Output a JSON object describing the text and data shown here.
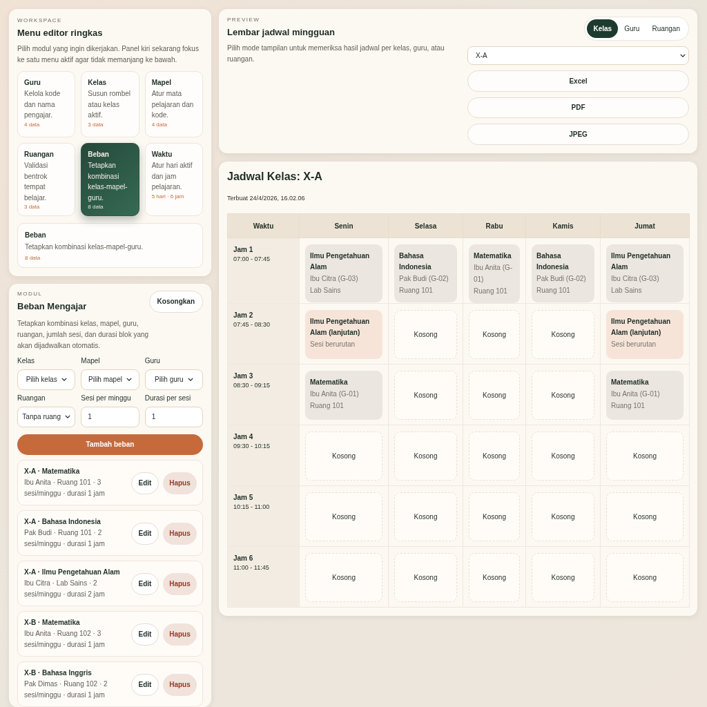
{
  "workspace": {
    "eyebrow": "WORKSPACE",
    "title": "Menu editor ringkas",
    "description": "Pilih modul yang ingin dikerjakan. Panel kiri sekarang fokus ke satu menu aktif agar tidak memanjang ke bawah.",
    "modules": [
      {
        "title": "Guru",
        "description": "Kelola kode dan nama pengajar.",
        "count": "4 data",
        "selected": false
      },
      {
        "title": "Kelas",
        "description": "Susun rombel atau kelas aktif.",
        "count": "3 data",
        "selected": false
      },
      {
        "title": "Mapel",
        "description": "Atur mata pelajaran dan kode.",
        "count": "4 data",
        "selected": false
      },
      {
        "title": "Ruangan",
        "description": "Validasi bentrok tempat belajar.",
        "count": "3 data",
        "selected": false
      },
      {
        "title": "Beban",
        "description": "Tetapkan kombinasi kelas-mapel-guru.",
        "count": "8 data",
        "selected": true
      },
      {
        "title": "Waktu",
        "description": "Atur hari aktif dan jam pelajaran.",
        "count": "5 hari · 6 jam",
        "selected": false
      }
    ],
    "active": {
      "title": "Beban",
      "description": "Tetapkan kombinasi kelas-mapel-guru.",
      "count": "8 data"
    }
  },
  "module": {
    "eyebrow": "MODUL",
    "title": "Beban Mengajar",
    "clear_button": "Kosongkan",
    "description": "Tetapkan kombinasi kelas, mapel, guru, ruangan, jumlah sesi, dan durasi blok yang akan dijadwalkan otomatis.",
    "fields": [
      {
        "label": "Kelas",
        "kind": "select",
        "value": "Pilih kelas"
      },
      {
        "label": "Mapel",
        "kind": "select",
        "value": "Pilih mapel"
      },
      {
        "label": "Guru",
        "kind": "select",
        "value": "Pilih guru"
      },
      {
        "label": "Ruangan",
        "kind": "select",
        "value": "Tanpa ruang"
      },
      {
        "label": "Sesi per minggu",
        "kind": "number",
        "value": "1"
      },
      {
        "label": "Durasi per sesi",
        "kind": "number",
        "value": "1"
      }
    ],
    "submit_button": "Tambah beban",
    "loads": [
      {
        "title": "X-A · Matematika",
        "detail": "Ibu Anita · Ruang 101 · 3 sesi/minggu · durasi 1 jam",
        "edit": "Edit",
        "delete": "Hapus"
      },
      {
        "title": "X-A · Bahasa Indonesia",
        "detail": "Pak Budi · Ruang 101 · 2 sesi/minggu · durasi 1 jam",
        "edit": "Edit",
        "delete": "Hapus"
      },
      {
        "title": "X-A · Ilmu Pengetahuan Alam",
        "detail": "Ibu Citra · Lab Sains · 2 sesi/minggu · durasi 2 jam",
        "edit": "Edit",
        "delete": "Hapus"
      },
      {
        "title": "X-B · Matematika",
        "detail": "Ibu Anita · Ruang 102 · 3 sesi/minggu · durasi 1 jam",
        "edit": "Edit",
        "delete": "Hapus"
      },
      {
        "title": "X-B · Bahasa Inggris",
        "detail": "Pak Dimas · Ruang 102 · 2 sesi/minggu · durasi 1 jam",
        "edit": "Edit",
        "delete": "Hapus"
      }
    ]
  },
  "preview": {
    "eyebrow": "PREVIEW",
    "title": "Lembar jadwal mingguan",
    "description": "Pilih mode tampilan untuk memeriksa hasil jadwal per kelas, guru, atau ruangan.",
    "modes": [
      {
        "label": "Kelas",
        "selected": true
      },
      {
        "label": "Guru",
        "selected": false
      },
      {
        "label": "Ruangan",
        "selected": false
      }
    ],
    "target": "X-A",
    "exports": [
      "Excel",
      "PDF",
      "JPEG"
    ]
  },
  "schedule": {
    "title": "Jadwal Kelas: X-A",
    "generated": "Terbuat 24/4/2026, 16.02.06",
    "columns": [
      "Waktu",
      "Senin",
      "Selasa",
      "Rabu",
      "Kamis",
      "Jumat"
    ],
    "rows": [
      {
        "cells": [
          {
            "kind": "time",
            "title": "Jam 1",
            "lines": [
              "07:00 - 07:45"
            ]
          },
          {
            "kind": "lesson",
            "title": "Ilmu Pengetahuan Alam",
            "lines": [
              "Ibu Citra (G-03)",
              "Lab Sains"
            ]
          },
          {
            "kind": "lesson",
            "title": "Bahasa Indonesia",
            "lines": [
              "Pak Budi (G-02)",
              "Ruang 101"
            ]
          },
          {
            "kind": "lesson",
            "title": "Matematika",
            "lines": [
              "Ibu Anita (G-01)",
              "Ruang 101"
            ]
          },
          {
            "kind": "lesson",
            "title": "Bahasa Indonesia",
            "lines": [
              "Pak Budi (G-02)",
              "Ruang 101"
            ]
          },
          {
            "kind": "lesson",
            "title": "Ilmu Pengetahuan Alam",
            "lines": [
              "Ibu Citra (G-03)",
              "Lab Sains"
            ]
          }
        ]
      },
      {
        "cells": [
          {
            "kind": "time",
            "title": "Jam 2",
            "lines": [
              "07:45 - 08:30"
            ]
          },
          {
            "kind": "continuation",
            "title": "Ilmu Pengetahuan Alam (lanjutan)",
            "lines": [
              "Sesi berurutan"
            ]
          },
          {
            "kind": "empty",
            "title": "Kosong"
          },
          {
            "kind": "empty",
            "title": "Kosong"
          },
          {
            "kind": "empty",
            "title": "Kosong"
          },
          {
            "kind": "continuation",
            "title": "Ilmu Pengetahuan Alam (lanjutan)",
            "lines": [
              "Sesi berurutan"
            ]
          }
        ]
      },
      {
        "cells": [
          {
            "kind": "time",
            "title": "Jam 3",
            "lines": [
              "08:30 - 09:15"
            ]
          },
          {
            "kind": "lesson",
            "title": "Matematika",
            "lines": [
              "Ibu Anita (G-01)",
              "Ruang 101"
            ]
          },
          {
            "kind": "empty",
            "title": "Kosong"
          },
          {
            "kind": "empty",
            "title": "Kosong"
          },
          {
            "kind": "empty",
            "title": "Kosong"
          },
          {
            "kind": "lesson",
            "title": "Matematika",
            "lines": [
              "Ibu Anita (G-01)",
              "Ruang 101"
            ]
          }
        ]
      },
      {
        "cells": [
          {
            "kind": "time",
            "title": "Jam 4",
            "lines": [
              "09:30 - 10:15"
            ]
          },
          {
            "kind": "empty",
            "title": "Kosong"
          },
          {
            "kind": "empty",
            "title": "Kosong"
          },
          {
            "kind": "empty",
            "title": "Kosong"
          },
          {
            "kind": "empty",
            "title": "Kosong"
          },
          {
            "kind": "empty",
            "title": "Kosong"
          }
        ]
      },
      {
        "cells": [
          {
            "kind": "time",
            "title": "Jam 5",
            "lines": [
              "10:15 - 11:00"
            ]
          },
          {
            "kind": "empty",
            "title": "Kosong"
          },
          {
            "kind": "empty",
            "title": "Kosong"
          },
          {
            "kind": "empty",
            "title": "Kosong"
          },
          {
            "kind": "empty",
            "title": "Kosong"
          },
          {
            "kind": "empty",
            "title": "Kosong"
          }
        ]
      },
      {
        "cells": [
          {
            "kind": "time",
            "title": "Jam 6",
            "lines": [
              "11:00 - 11:45"
            ]
          },
          {
            "kind": "empty",
            "title": "Kosong"
          },
          {
            "kind": "empty",
            "title": "Kosong"
          },
          {
            "kind": "empty",
            "title": "Kosong"
          },
          {
            "kind": "empty",
            "title": "Kosong"
          },
          {
            "kind": "empty",
            "title": "Kosong"
          }
        ]
      }
    ]
  }
}
